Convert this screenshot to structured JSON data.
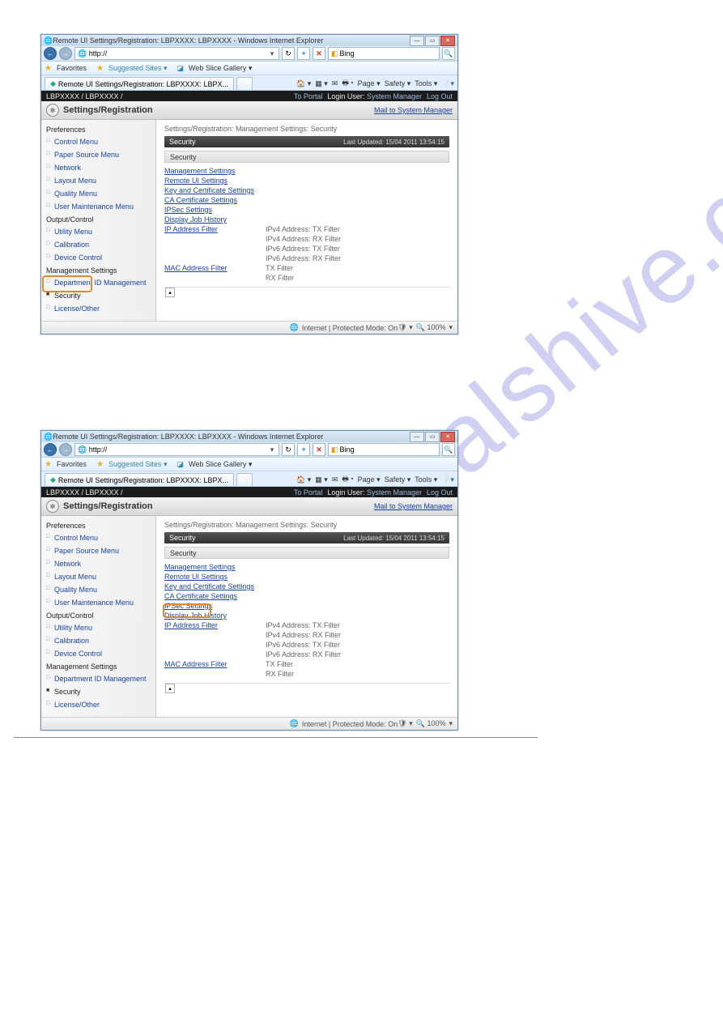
{
  "watermark_text": "manualshive.com",
  "window": {
    "title": "Remote UI Settings/Registration: LBPXXXX: LBPXXXX - Windows Internet Explorer",
    "address_prefix": "http://",
    "search_placeholder": "Bing",
    "fav_label": "Favorites",
    "suggested": "Suggested Sites ▾",
    "webslice": "Web Slice Gallery ▾",
    "tab_label": "Remote UI Settings/Registration: LBPXXXX: LBPX...",
    "page_menu": "Page ▾",
    "safety_menu": "Safety ▾",
    "tools_menu": "Tools ▾",
    "status": "Internet | Protected Mode: On",
    "zoom": "100%"
  },
  "device": {
    "path": "LBPXXXX / LBPXXXX /",
    "to_portal": "To Portal",
    "login_text": "Login User: ",
    "login_user": "System Manager",
    "logout": "Log Out"
  },
  "header": {
    "title": "Settings/Registration",
    "mailto": "Mail to System Manager"
  },
  "breadcrumb": "Settings/Registration: Management Settings: Security",
  "security_bar": {
    "label": "Security",
    "timestamp": "Last Updated: 15/04 2011 13:54:15"
  },
  "sub_bar": "Security",
  "nav": {
    "preferences": "Preferences",
    "control": "Control Menu",
    "paper": "Paper Source Menu",
    "network": "Network",
    "layout": "Layout Menu",
    "quality": "Quality Menu",
    "user_maint": "User Maintenance Menu",
    "output": "Output/Control",
    "utility": "Utility Menu",
    "calibration": "Calibration",
    "device_control": "Device Control",
    "mgmt": "Management Settings",
    "dept_id": "Department ID Management",
    "security": "Security",
    "license": "License/Other"
  },
  "links": {
    "mgmt_settings": "Management Settings",
    "remote_ui": "Remote UI Settings",
    "key_cert": "Key and Certificate Settings",
    "ca_cert": "CA Certificate Settings",
    "ipsec": "IPSec Settings",
    "job_history": "Display Job History",
    "ip_filter": "IP Address Filter",
    "mac_filter": "MAC Address Filter"
  },
  "filter_rows": {
    "ipv4_tx": "IPv4 Address: TX Filter",
    "ipv4_rx": "IPv4 Address: RX Filter",
    "ipv6_tx": "IPv6 Address: TX Filter",
    "ipv6_rx": "IPv6 Address: RX Filter",
    "mac_tx": "TX Filter",
    "mac_rx": "RX Filter"
  }
}
